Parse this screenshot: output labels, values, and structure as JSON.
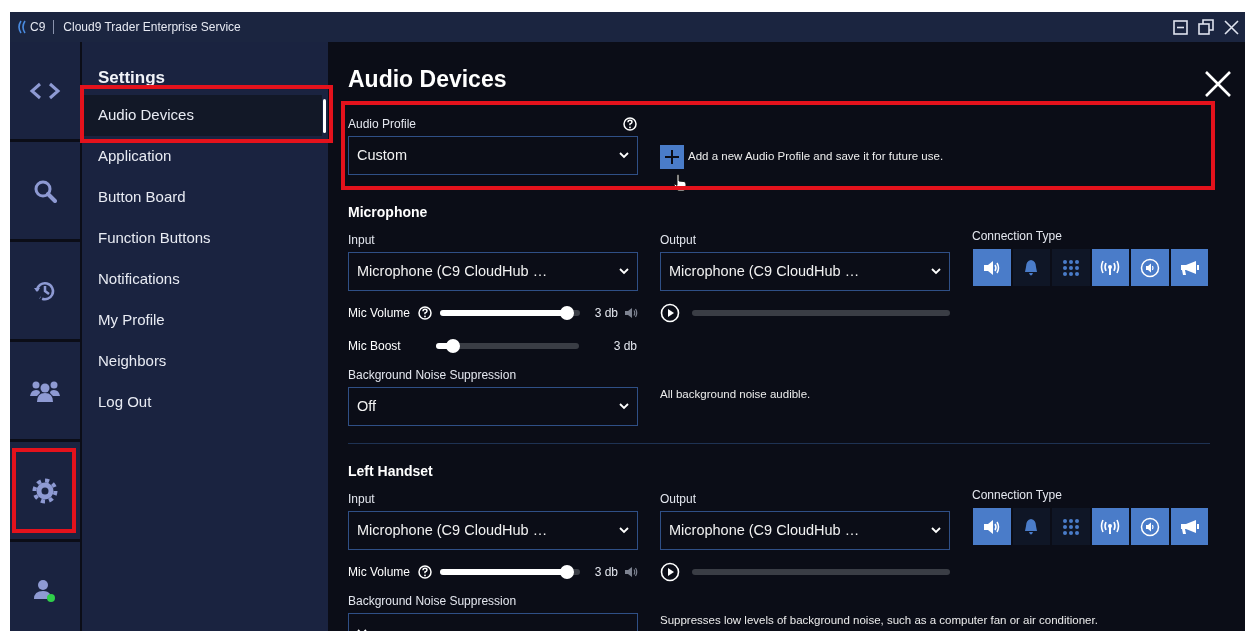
{
  "window": {
    "logo": "C9",
    "title": "Cloud9 Trader Enterprise Service"
  },
  "rail": [
    {
      "kind": "code",
      "highlighted": false
    },
    {
      "kind": "search",
      "highlighted": false
    },
    {
      "kind": "history",
      "highlighted": false
    },
    {
      "kind": "users",
      "highlighted": false
    },
    {
      "kind": "gear",
      "highlighted": true
    },
    {
      "kind": "user",
      "highlighted": false
    }
  ],
  "settings_nav": {
    "title": "Settings",
    "items": [
      {
        "label": "Audio Devices",
        "selected": true,
        "highlighted": true
      },
      {
        "label": "Application",
        "selected": false,
        "highlighted": false
      },
      {
        "label": "Button Board",
        "selected": false,
        "highlighted": false
      },
      {
        "label": "Function Buttons",
        "selected": false,
        "highlighted": false
      },
      {
        "label": "Notifications",
        "selected": false,
        "highlighted": false
      },
      {
        "label": "My Profile",
        "selected": false,
        "highlighted": false
      },
      {
        "label": "Neighbors",
        "selected": false,
        "highlighted": false
      },
      {
        "label": "Log Out",
        "selected": false,
        "highlighted": false
      }
    ]
  },
  "page": {
    "title": "Audio Devices"
  },
  "audio_profile": {
    "label": "Audio Profile",
    "value": "Custom",
    "add_hint": "Add a new Audio Profile and save it for future use.",
    "highlighted": true
  },
  "sections": [
    {
      "title": "Microphone",
      "input_label": "Input",
      "input_value": "Microphone (C9 CloudHub …",
      "output_label": "Output",
      "output_value": "Microphone (C9 CloudHub …",
      "connection_label": "Connection Type",
      "connection_types": [
        {
          "kind": "speaker",
          "selected": true
        },
        {
          "kind": "bell",
          "selected": false
        },
        {
          "kind": "keypad",
          "selected": false
        },
        {
          "kind": "antenna",
          "selected": true
        },
        {
          "kind": "ring",
          "selected": true
        },
        {
          "kind": "megaphone",
          "selected": true
        }
      ],
      "sliders": [
        {
          "kind": "volume",
          "label": "Mic Volume",
          "level": 0.91,
          "reading": "3 db"
        },
        {
          "kind": "boost",
          "label": "Mic Boost",
          "level": 0.12,
          "reading": "3 db"
        }
      ],
      "noise_label": "Background Noise Suppression",
      "noise_value": "Off",
      "noise_hint": "All background noise audible."
    },
    {
      "title": "Left Handset",
      "input_label": "Input",
      "input_value": "Microphone (C9 CloudHub …",
      "output_label": "Output",
      "output_value": "Microphone (C9 CloudHub …",
      "connection_label": "Connection Type",
      "connection_types": [
        {
          "kind": "speaker",
          "selected": true
        },
        {
          "kind": "bell",
          "selected": false
        },
        {
          "kind": "keypad",
          "selected": false
        },
        {
          "kind": "antenna",
          "selected": true
        },
        {
          "kind": "ring",
          "selected": true
        },
        {
          "kind": "megaphone",
          "selected": true
        }
      ],
      "sliders": [
        {
          "kind": "volume",
          "label": "Mic Volume",
          "level": 0.91,
          "reading": "3 db"
        }
      ],
      "noise_label": "Background Noise Suppression",
      "noise_hint": "Suppresses low levels of background noise, such as a computer fan or air conditioner."
    }
  ]
}
